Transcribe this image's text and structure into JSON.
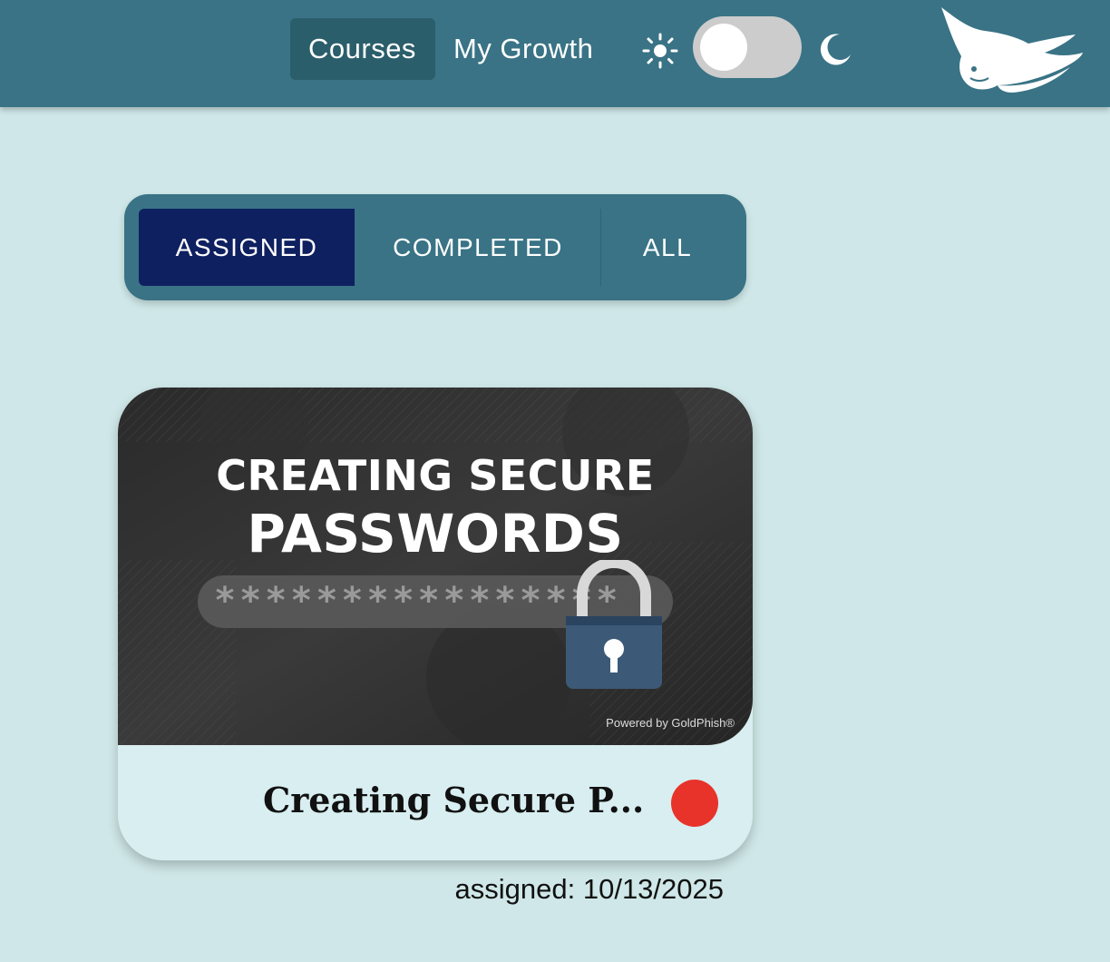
{
  "nav": {
    "courses_label": "Courses",
    "growth_label": "My Growth",
    "theme_toggle": {
      "light_icon": "sun-icon",
      "dark_icon": "moon-icon",
      "dark_mode": false
    },
    "logo_icon": "manta-ray-logo"
  },
  "tabs": {
    "items": [
      {
        "label": "ASSIGNED",
        "active": true
      },
      {
        "label": "COMPLETED",
        "active": false
      },
      {
        "label": "ALL",
        "active": false
      }
    ]
  },
  "course": {
    "thumbnail_title_line1": "CREATING SECURE",
    "thumbnail_title_line2": "PASSWORDS",
    "thumbnail_password_mask": "****************",
    "thumbnail_credit": "Powered by GoldPhish®",
    "thumbnail_icon": "padlock-icon",
    "title": "Creating Secure P...",
    "status_color": "#e8332a",
    "assigned_text": "assigned: 10/13/2025"
  },
  "colors": {
    "header": "#397385",
    "background": "#cfe7e8",
    "active_tab": "#0f2060",
    "card": "#d8eef0"
  }
}
